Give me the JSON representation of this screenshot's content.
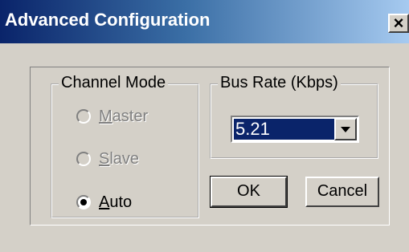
{
  "window": {
    "title": "Advanced Configuration",
    "close_label": "×"
  },
  "channel_mode": {
    "title": "Channel Mode",
    "options": [
      {
        "label": "Master",
        "mnemonic": "M",
        "rest": "aster",
        "enabled": false,
        "selected": false
      },
      {
        "label": "Slave",
        "mnemonic": "S",
        "rest": "lave",
        "enabled": false,
        "selected": false
      },
      {
        "label": "Auto",
        "mnemonic": "A",
        "rest": "uto",
        "enabled": true,
        "selected": true
      }
    ]
  },
  "bus_rate": {
    "title": "Bus Rate (Kbps)",
    "selected_value": "5.21"
  },
  "buttons": {
    "ok": "OK",
    "cancel": "Cancel"
  }
}
